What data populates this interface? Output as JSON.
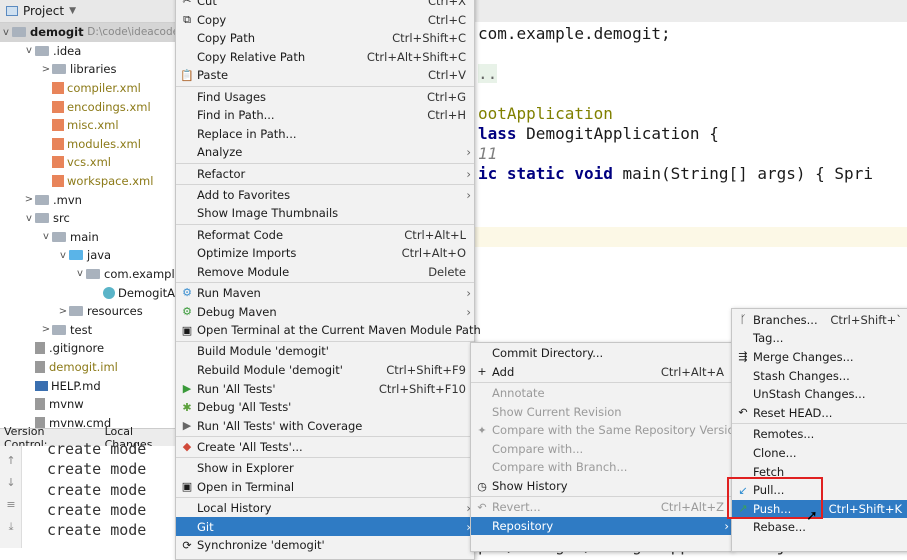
{
  "project": {
    "header": "Project",
    "root": "demogit",
    "root_path": "D:\\code\\ideacode",
    "tree": [
      {
        "label": ".idea",
        "depth": 1,
        "chev": "v",
        "icon": "folder"
      },
      {
        "label": "libraries",
        "depth": 2,
        "chev": ">",
        "icon": "folder"
      },
      {
        "label": "compiler.xml",
        "depth": 2,
        "icon": "xml"
      },
      {
        "label": "encodings.xml",
        "depth": 2,
        "icon": "xml"
      },
      {
        "label": "misc.xml",
        "depth": 2,
        "icon": "xml"
      },
      {
        "label": "modules.xml",
        "depth": 2,
        "icon": "xml"
      },
      {
        "label": "vcs.xml",
        "depth": 2,
        "icon": "xml"
      },
      {
        "label": "workspace.xml",
        "depth": 2,
        "icon": "xml"
      },
      {
        "label": ".mvn",
        "depth": 1,
        "chev": ">",
        "icon": "folder"
      },
      {
        "label": "src",
        "depth": 1,
        "chev": "v",
        "icon": "folder"
      },
      {
        "label": "main",
        "depth": 2,
        "chev": "v",
        "icon": "folder"
      },
      {
        "label": "java",
        "depth": 3,
        "chev": "v",
        "icon": "folder-blue"
      },
      {
        "label": "com.example.",
        "depth": 4,
        "chev": "v",
        "icon": "folder"
      },
      {
        "label": "DemogitAp",
        "depth": 5,
        "icon": "class"
      },
      {
        "label": "resources",
        "depth": 3,
        "chev": ">",
        "icon": "folder"
      },
      {
        "label": "test",
        "depth": 2,
        "chev": ">",
        "icon": "folder"
      },
      {
        "label": ".gitignore",
        "depth": 1,
        "icon": "file"
      },
      {
        "label": "demogit.iml",
        "depth": 1,
        "icon": "file",
        "xml": true
      },
      {
        "label": "HELP.md",
        "depth": 1,
        "icon": "md"
      },
      {
        "label": "mvnw",
        "depth": 1,
        "icon": "file"
      },
      {
        "label": "mvnw.cmd",
        "depth": 1,
        "icon": "file"
      }
    ]
  },
  "version_control": {
    "label": "Version Control:",
    "tab": "Local Changes"
  },
  "console": {
    "lines": [
      "create mode",
      "create mode",
      "create mode",
      "create mode",
      "create mode"
    ]
  },
  "editor": {
    "line1": "com.example.demogit;",
    "fold": "..",
    "ann": "ootApplication",
    "class_kw": "lass",
    "class_name": "DemogitApplication {",
    "comment": "11",
    "main_kw": "ic static void",
    "main_rest": "main(String[] args) { Spri",
    "bottom": "ple/demogit/DemogitApplication.java"
  },
  "context_menu": {
    "items": [
      {
        "label": "Cut",
        "shortcut": "Ctrl+X",
        "icon": "✂"
      },
      {
        "label": "Copy",
        "shortcut": "Ctrl+C",
        "icon": "⧉"
      },
      {
        "label": "Copy Path",
        "shortcut": "Ctrl+Shift+C"
      },
      {
        "label": "Copy Relative Path",
        "shortcut": "Ctrl+Alt+Shift+C"
      },
      {
        "label": "Paste",
        "shortcut": "Ctrl+V",
        "icon": "📋"
      },
      {
        "sep": true
      },
      {
        "label": "Find Usages",
        "shortcut": "Ctrl+G"
      },
      {
        "label": "Find in Path...",
        "shortcut": "Ctrl+H"
      },
      {
        "label": "Replace in Path..."
      },
      {
        "label": "Analyze",
        "submenu": true
      },
      {
        "sep": true
      },
      {
        "label": "Refactor",
        "submenu": true
      },
      {
        "sep": true
      },
      {
        "label": "Add to Favorites",
        "submenu": true
      },
      {
        "label": "Show Image Thumbnails"
      },
      {
        "sep": true
      },
      {
        "label": "Reformat Code",
        "shortcut": "Ctrl+Alt+L"
      },
      {
        "label": "Optimize Imports",
        "shortcut": "Ctrl+Alt+O"
      },
      {
        "label": "Remove Module",
        "shortcut": "Delete"
      },
      {
        "sep": true
      },
      {
        "label": "Run Maven",
        "submenu": true,
        "icon": "⚙",
        "icon_color": "#3b8fd0"
      },
      {
        "label": "Debug Maven",
        "submenu": true,
        "icon": "⚙",
        "icon_color": "#3a9a3a"
      },
      {
        "label": "Open Terminal at the Current Maven Module Path",
        "icon": "▣"
      },
      {
        "sep": true
      },
      {
        "label": "Build Module 'demogit'"
      },
      {
        "label": "Rebuild Module 'demogit'",
        "shortcut": "Ctrl+Shift+F9"
      },
      {
        "label": "Run 'All Tests'",
        "shortcut": "Ctrl+Shift+F10",
        "icon": "▶",
        "icon_color": "#3a9a3a"
      },
      {
        "label": "Debug 'All Tests'",
        "icon": "✱",
        "icon_color": "#5aa03a"
      },
      {
        "label": "Run 'All Tests' with Coverage",
        "icon": "▶",
        "icon_color": "#666"
      },
      {
        "sep": true
      },
      {
        "label": "Create 'All Tests'...",
        "icon": "◆",
        "icon_color": "#d04a3a"
      },
      {
        "sep": true
      },
      {
        "label": "Show in Explorer"
      },
      {
        "label": "Open in Terminal",
        "icon": "▣"
      },
      {
        "sep": true
      },
      {
        "label": "Local History",
        "submenu": true
      },
      {
        "label": "Git",
        "submenu": true,
        "selected": true
      },
      {
        "label": "Synchronize 'demogit'",
        "icon": "⟳"
      }
    ]
  },
  "git_menu": {
    "items": [
      {
        "label": "Commit Directory..."
      },
      {
        "label": "Add",
        "shortcut": "Ctrl+Alt+A",
        "icon": "+"
      },
      {
        "sep": true
      },
      {
        "label": "Annotate",
        "disabled": true
      },
      {
        "label": "Show Current Revision",
        "disabled": true
      },
      {
        "label": "Compare with the Same Repository Version",
        "disabled": true,
        "icon": "✦"
      },
      {
        "label": "Compare with...",
        "disabled": true
      },
      {
        "label": "Compare with Branch...",
        "disabled": true
      },
      {
        "label": "Show History",
        "icon": "◷"
      },
      {
        "sep": true
      },
      {
        "label": "Revert...",
        "shortcut": "Ctrl+Alt+Z",
        "disabled": true,
        "icon": "↶"
      },
      {
        "label": "Repository",
        "submenu": true,
        "selected": true
      }
    ]
  },
  "repository_menu": {
    "items": [
      {
        "label": "Branches...",
        "shortcut": "Ctrl+Shift+`",
        "icon": "ᚴ"
      },
      {
        "label": "Tag..."
      },
      {
        "label": "Merge Changes...",
        "icon": "⇶"
      },
      {
        "label": "Stash Changes..."
      },
      {
        "label": "UnStash Changes..."
      },
      {
        "label": "Reset HEAD...",
        "icon": "↶"
      },
      {
        "sep": true
      },
      {
        "label": "Remotes..."
      },
      {
        "label": "Clone..."
      },
      {
        "label": "Fetch"
      },
      {
        "label": "Pull...",
        "icon": "↙",
        "icon_color": "#2a8ad0"
      },
      {
        "label": "Push...",
        "shortcut": "Ctrl+Shift+K",
        "icon": "↗",
        "icon_color": "#3aa05a",
        "selected": true
      },
      {
        "label": "Rebase..."
      }
    ]
  },
  "colors": {
    "selection": "#2f7bc4",
    "highlight_box": "#e02020"
  }
}
